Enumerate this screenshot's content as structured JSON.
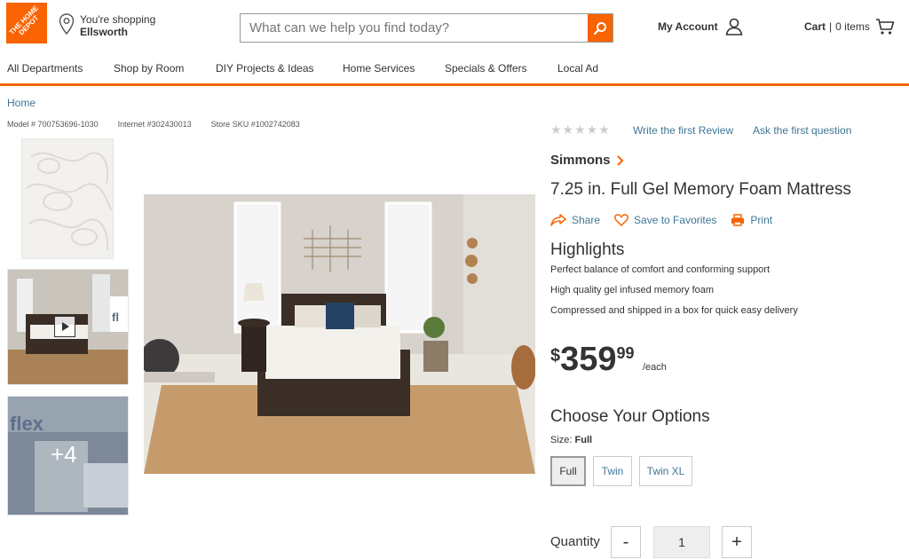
{
  "header": {
    "logo_text": "THE HOME DEPOT",
    "store_prefix": "You're shopping",
    "store_name": "Ellsworth",
    "search_placeholder": "What can we help you find today?",
    "account_label": "My Account",
    "cart_label": "Cart",
    "cart_count": "0 items"
  },
  "nav": {
    "items": [
      "All Departments",
      "Shop by Room",
      "DIY Projects & Ideas",
      "Home Services",
      "Specials & Offers",
      "Local Ad"
    ]
  },
  "breadcrumb": "Home",
  "ids": {
    "model": "Model # 700753696-1030",
    "internet": "Internet #302430013",
    "sku": "Store SKU #1002742083"
  },
  "thumbnails": {
    "more_count": "+4"
  },
  "product": {
    "stars": "★★★★★",
    "review_link": "Write the first Review",
    "question_link": "Ask the first question",
    "brand": "Simmons",
    "title": "7.25 in. Full Gel Memory Foam Mattress",
    "actions": [
      "Share",
      "Save to Favorites",
      "Print"
    ],
    "highlights_title": "Highlights",
    "highlights": [
      "Perfect balance of comfort and conforming support",
      "High quality gel infused memory foam",
      "Compressed and shipped in a box for quick easy delivery"
    ],
    "price": {
      "currency": "$",
      "dollars": "359",
      "cents": "99",
      "unit": "/each"
    },
    "options_title": "Choose Your Options",
    "size_prefix": "Size:",
    "size_selected": "Full",
    "sizes": [
      "Full",
      "Twin",
      "Twin XL"
    ],
    "quantity_label": "Quantity",
    "quantity": "1",
    "qty_minus": "-",
    "qty_plus": "+"
  },
  "colors": {
    "brand_orange": "#f96302",
    "link_blue": "#3e7697"
  },
  "icons": [
    "location-pin-icon",
    "search-icon",
    "user-icon",
    "cart-icon",
    "chevron-right-icon",
    "share-icon",
    "heart-icon",
    "print-icon",
    "play-icon"
  ]
}
